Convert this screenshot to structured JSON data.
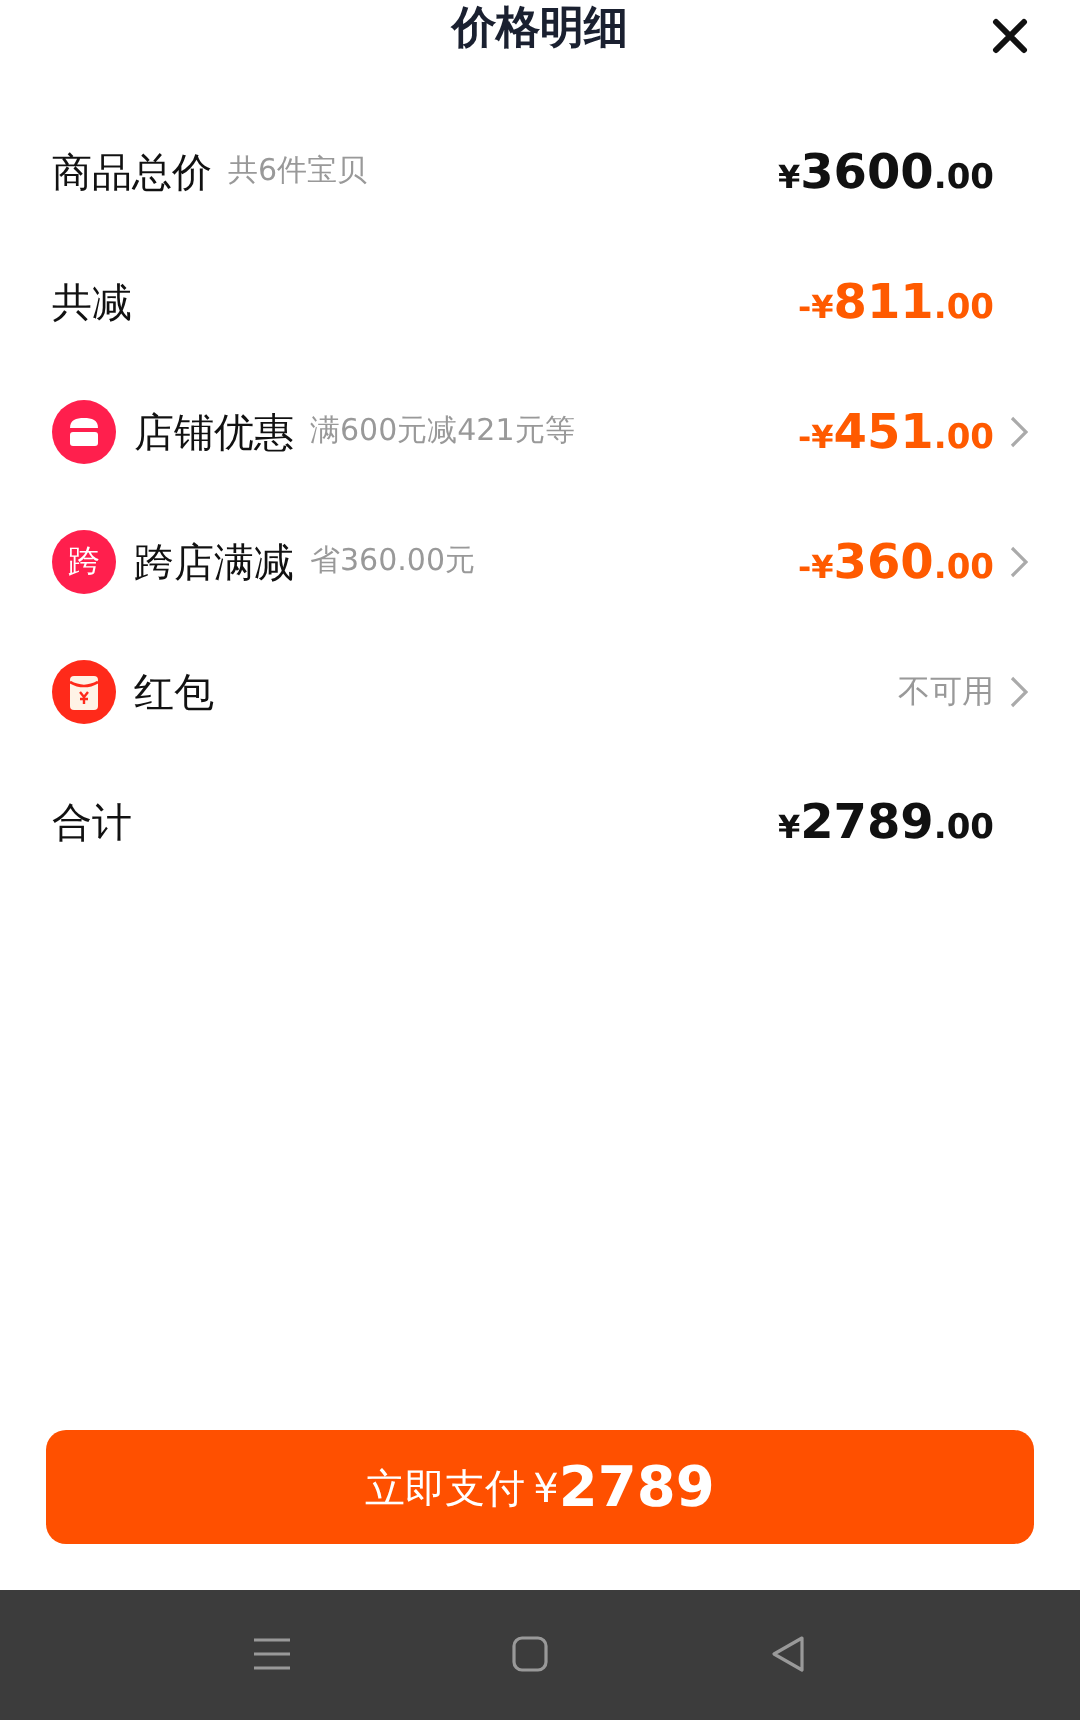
{
  "header": {
    "title": "价格明细"
  },
  "rows": [
    {
      "kind": "plain",
      "label": "商品总价",
      "note": "共6件宝贝",
      "color": "#111111",
      "amount": {
        "symbol": "¥",
        "whole": "3600",
        "fraction": ".00"
      },
      "arrow": false
    },
    {
      "kind": "plain",
      "label": "共减",
      "color": "#ff5a00",
      "amount": {
        "sign": "-",
        "symbol": "¥",
        "whole": "811",
        "fraction": ".00"
      },
      "arrow": false
    },
    {
      "kind": "shop",
      "label": "店铺优惠",
      "note": "满600元减421元等",
      "color": "#ff5a00",
      "amount": {
        "sign": "-",
        "symbol": "¥",
        "whole": "451",
        "fraction": ".00"
      },
      "arrow": true
    },
    {
      "kind": "cross_store",
      "badge": "跨",
      "label": "跨店满减",
      "note": "省360.00元",
      "color": "#ff5a00",
      "amount": {
        "sign": "-",
        "symbol": "¥",
        "whole": "360",
        "fraction": ".00"
      },
      "arrow": true
    },
    {
      "kind": "red_packet",
      "label": "红包",
      "status": "不可用",
      "arrow": true
    },
    {
      "kind": "plain",
      "label": "合计",
      "color": "#111111",
      "amount": {
        "symbol": "¥",
        "whole": "2789",
        "fraction": ".00"
      },
      "arrow": false
    }
  ],
  "pay_button": {
    "label": "立即支付",
    "symbol": "¥",
    "amount": "2789"
  }
}
